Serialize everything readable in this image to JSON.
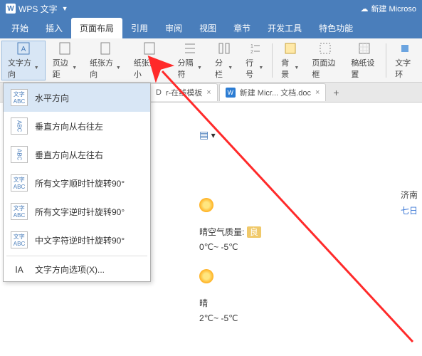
{
  "titlebar": {
    "appname": "WPS 文字",
    "rightdoc": "新建 Microso"
  },
  "menubar": {
    "tabs": [
      "开始",
      "插入",
      "页面布局",
      "引用",
      "审阅",
      "视图",
      "章节",
      "开发工具",
      "特色功能"
    ],
    "active_index": 2
  },
  "ribbon": {
    "items": [
      {
        "label": "文字方向"
      },
      {
        "label": "页边距"
      },
      {
        "label": "纸张方向"
      },
      {
        "label": "纸张大小"
      },
      {
        "label": "分隔符"
      },
      {
        "label": "分栏"
      },
      {
        "label": "行号"
      },
      {
        "label": "背景"
      },
      {
        "label": "页面边框"
      },
      {
        "label": "稿纸设置"
      },
      {
        "label": "文字环"
      }
    ]
  },
  "tabstrip": {
    "tab0": "r-在线模板",
    "tab0_partial": "D",
    "tab1": "新建 Micr... 文档.doc",
    "add": "+"
  },
  "textdir_menu": {
    "items": [
      {
        "icon": "文字\\nABC",
        "label": "水平方向",
        "selected": true
      },
      {
        "icon": "ABC",
        "label": "垂直方向从右往左"
      },
      {
        "icon": "ABC",
        "label": "垂直方向从左往右"
      },
      {
        "icon": "文字\\nABC",
        "label": "所有文字顺时针旋转90°"
      },
      {
        "icon": "文字\\nABC",
        "label": "所有文字逆时针旋转90°"
      },
      {
        "icon": "文字\\nABC",
        "label": "中文字符逆时针旋转90°"
      }
    ],
    "options": "文字方向选项(X)..."
  },
  "document": {
    "city": "济南",
    "date": "七日",
    "air_label": "晴空气质量:",
    "air_value": "良",
    "temp1": "0℃~ -5℃",
    "cond2": "晴",
    "temp2": "2℃~ -5℃"
  }
}
